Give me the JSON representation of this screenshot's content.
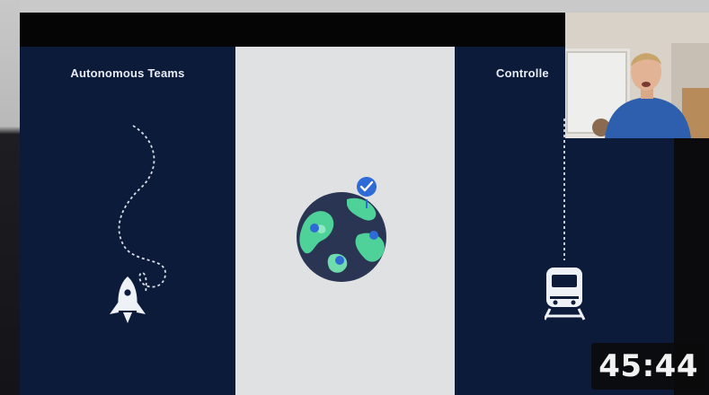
{
  "slide": {
    "panels": [
      {
        "title": "Autonomous Teams",
        "illustration": "rocket-icon"
      },
      {
        "title": "",
        "illustration": "globe-icon"
      },
      {
        "title": "Controlle",
        "illustration": "train-icon"
      }
    ]
  },
  "video": {
    "duration": "45:44",
    "webcam": "presenter-webcam"
  },
  "colors": {
    "slide_dark": "#0c1b3a",
    "slide_light": "#dfe1e3",
    "globe_ocean": "#2a3553",
    "globe_land": "#4fd19a",
    "pin_blue": "#2f6bd6"
  }
}
